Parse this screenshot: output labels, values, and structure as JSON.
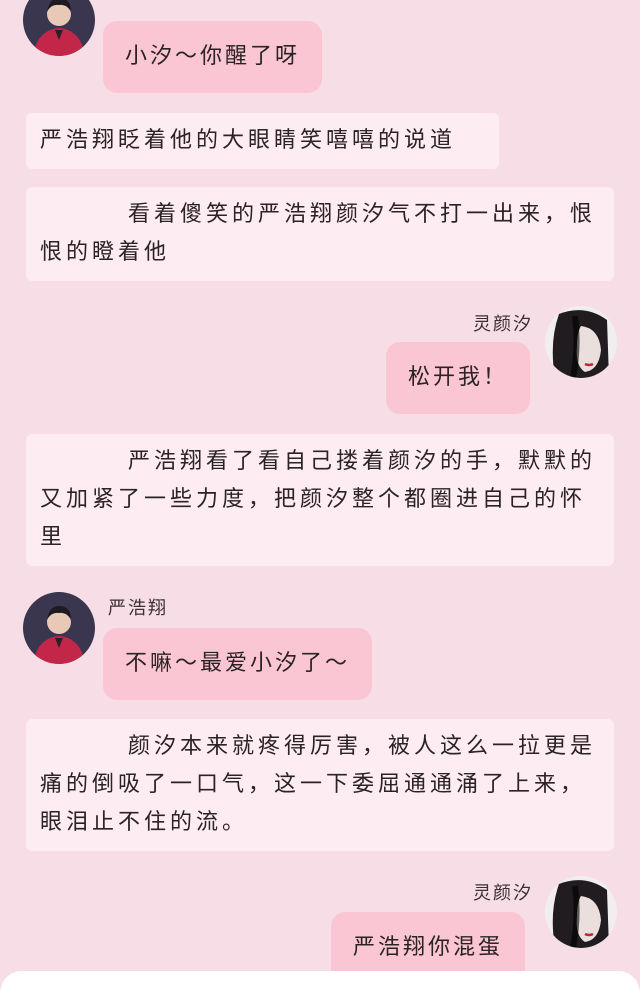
{
  "messages": [
    {
      "type": "bubble_left",
      "text": "小汐～你醒了呀"
    },
    {
      "type": "narration",
      "text": "严浩翔眨着他的大眼睛笑嘻嘻的说道"
    },
    {
      "type": "narration",
      "text": "看着傻笑的严浩翔颜汐气不打一出来，恨恨的瞪着他"
    },
    {
      "type": "bubble_right",
      "sender": "灵颜汐",
      "text": "松开我！"
    },
    {
      "type": "narration",
      "text": "严浩翔看了看自己搂着颜汐的手，默默的又加紧了一些力度，把颜汐整个都圈进自己的怀里"
    },
    {
      "type": "bubble_left",
      "sender": "严浩翔",
      "text": "不嘛～最爱小汐了～"
    },
    {
      "type": "narration",
      "text": "颜汐本来就疼得厉害，被人这么一拉更是痛的倒吸了一口气，这一下委屈通通涌了上来，眼泪止不住的流。"
    },
    {
      "type": "bubble_right",
      "sender": "灵颜汐",
      "text": "严浩翔你混蛋"
    }
  ],
  "colors": {
    "background": "#f7dde5",
    "bubble": "#fbc6d3",
    "narration": "#fdecf1"
  },
  "avatars": {
    "left": "boy-avatar-red-suit",
    "right": "girl-avatar-dark-hair"
  }
}
